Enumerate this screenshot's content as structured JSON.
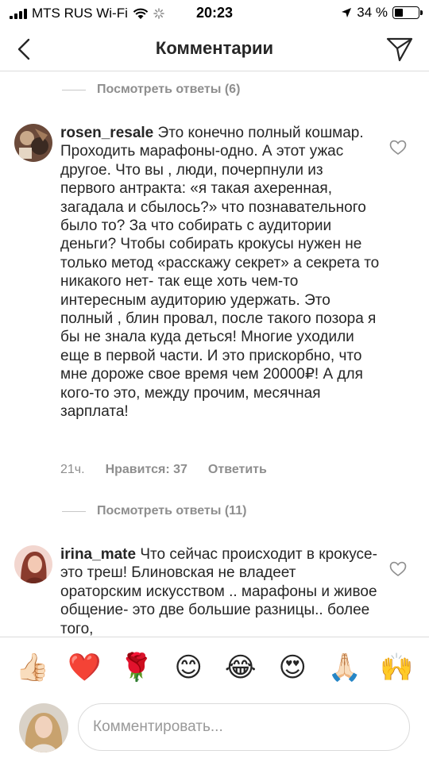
{
  "status_bar": {
    "carrier": "MTS RUS Wi-Fi",
    "time": "20:23",
    "battery_percent": "34 %",
    "battery_level": 0.34
  },
  "header": {
    "title": "Комментарии"
  },
  "replies_top": {
    "label": "Посмотреть ответы (6)"
  },
  "comments": [
    {
      "username": "rosen_resale",
      "text": "Это конечно полный кошмар. Проходить марафоны-одно. А этот ужас другое. Что вы , люди, почерпнули из первого антракта: «я такая ахеренная, загадала и сбылось?» что познавательного было то? За что собирать  с аудитории деньги? Чтобы собирать крокусы нужен не только метод «расскажу секрет» а секрета то никакого нет- так еще хоть чем-то интересным аудиторию удержать. Это полный , блин провал, после такого позора я бы не знала куда деться! Многие уходили еще в первой части. И это прискорбно, что мне дороже свое время чем 20000₽! А для кого-то это, между прочим, месячная зарплата!",
      "time": "21ч.",
      "likes": "Нравится: 37",
      "reply": "Ответить"
    },
    {
      "username": "irina_mate",
      "text": "Что сейчас происходит в крокусе- это треш! Блиновская не владеет ораторским искусством .. марафоны и живое общение- это две большие разницы.. более того,"
    }
  ],
  "replies_second": {
    "label": "Посмотреть ответы (11)"
  },
  "emoji_bar": [
    "👍🏻",
    "❤️",
    "🌹",
    "😊",
    "😂",
    "😍",
    "🙏🏻",
    "🙌"
  ],
  "input": {
    "placeholder": "Комментировать..."
  }
}
